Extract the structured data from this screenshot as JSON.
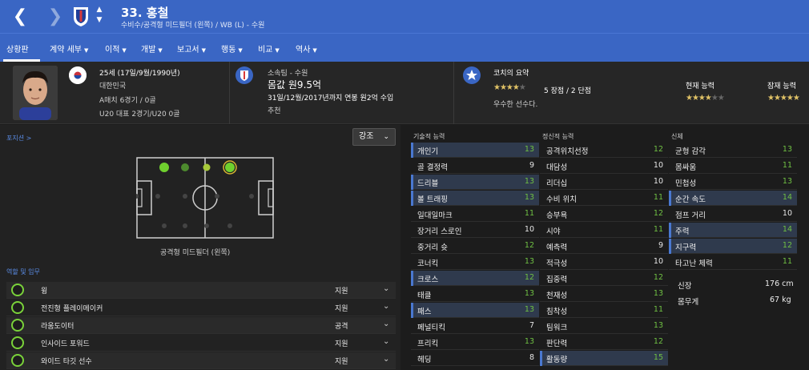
{
  "header": {
    "number_name": "33. 홍철",
    "subtitle": "수비수/공격형 미드필더 (왼쪽) / WB (L) - 수원"
  },
  "tabs": [
    {
      "label": "상황판"
    },
    {
      "label": "계약 세부"
    },
    {
      "label": "이적"
    },
    {
      "label": "개발"
    },
    {
      "label": "보고서"
    },
    {
      "label": "행동"
    },
    {
      "label": "비교"
    },
    {
      "label": "역사"
    }
  ],
  "profile": {
    "age_line": "25세 (17일/9월/1990년)",
    "nationality": "대한민국",
    "a_caps": "A매치 6경기 / 0골",
    "u20_caps": "U20 대표 2경기/U20 0골"
  },
  "contract": {
    "team_line": "소속팀 - 수원",
    "value_line": "몸값 원9.5억",
    "wage_line": "31일/12월/2017년까지 연봉 원2억 수입",
    "status": "추천"
  },
  "coach": {
    "title": "코치의 요약",
    "strengths": "5 장점 / 2 단점",
    "summary": "우수한 선수다.",
    "current_label": "현재 능력",
    "potential_label": "잠재 능력",
    "stars_summary": 3.5,
    "stars_current": 3.5,
    "stars_potential": 4.5
  },
  "position_panel": {
    "link": "포지션 >",
    "highlight_select": "강조",
    "position_label": "공격형 미드필더 (왼쪽)",
    "roles_title": "역할 및 임무"
  },
  "roles": [
    {
      "name": "윙",
      "duty": "지원"
    },
    {
      "name": "전진형 플레이메이커",
      "duty": "지원"
    },
    {
      "name": "라움도이터",
      "duty": "공격"
    },
    {
      "name": "인사이드 포워드",
      "duty": "지원"
    },
    {
      "name": "와이드 타깃 선수",
      "duty": "지원"
    }
  ],
  "technical": {
    "title": "기술적 능력",
    "attrs": [
      {
        "name": "개인기",
        "value": "13",
        "hl": true
      },
      {
        "name": "골 결정력",
        "value": "9",
        "hl": false
      },
      {
        "name": "드리블",
        "value": "13",
        "hl": true
      },
      {
        "name": "볼 트래핑",
        "value": "13",
        "hl": true
      },
      {
        "name": "일대일마크",
        "value": "11",
        "hl": false
      },
      {
        "name": "장거리 스로인",
        "value": "10",
        "hl": false
      },
      {
        "name": "중거리 슛",
        "value": "12",
        "hl": false
      },
      {
        "name": "코너킥",
        "value": "13",
        "hl": false
      },
      {
        "name": "크로스",
        "value": "12",
        "hl": true
      },
      {
        "name": "태클",
        "value": "13",
        "hl": false
      },
      {
        "name": "패스",
        "value": "13",
        "hl": true
      },
      {
        "name": "페널티킥",
        "value": "7",
        "hl": false
      },
      {
        "name": "프리킥",
        "value": "13",
        "hl": false
      },
      {
        "name": "헤딩",
        "value": "8",
        "hl": false
      }
    ]
  },
  "mental": {
    "title": "정신적 능력",
    "attrs": [
      {
        "name": "공격위치선정",
        "value": "12",
        "hl": false
      },
      {
        "name": "대담성",
        "value": "10",
        "hl": false
      },
      {
        "name": "리더십",
        "value": "10",
        "hl": false
      },
      {
        "name": "수비 위치",
        "value": "11",
        "hl": false
      },
      {
        "name": "승부욕",
        "value": "12",
        "hl": false
      },
      {
        "name": "시야",
        "value": "11",
        "hl": false
      },
      {
        "name": "예측력",
        "value": "9",
        "hl": false
      },
      {
        "name": "적극성",
        "value": "10",
        "hl": false
      },
      {
        "name": "집중력",
        "value": "12",
        "hl": false
      },
      {
        "name": "천재성",
        "value": "13",
        "hl": false
      },
      {
        "name": "침착성",
        "value": "11",
        "hl": false
      },
      {
        "name": "팀워크",
        "value": "13",
        "hl": false
      },
      {
        "name": "판단력",
        "value": "12",
        "hl": false
      },
      {
        "name": "활동량",
        "value": "15",
        "hl": true
      }
    ]
  },
  "physical": {
    "title": "신체",
    "attrs": [
      {
        "name": "균형 감각",
        "value": "13",
        "hl": false
      },
      {
        "name": "몸싸움",
        "value": "11",
        "hl": false
      },
      {
        "name": "민첩성",
        "value": "13",
        "hl": false
      },
      {
        "name": "순간 속도",
        "value": "14",
        "hl": true
      },
      {
        "name": "점프 거리",
        "value": "10",
        "hl": false
      },
      {
        "name": "주력",
        "value": "14",
        "hl": true
      },
      {
        "name": "지구력",
        "value": "12",
        "hl": true
      },
      {
        "name": "타고난 체력",
        "value": "11",
        "hl": false
      }
    ],
    "height_label": "신장",
    "height_value": "176 cm",
    "weight_label": "몸무게",
    "weight_value": "67 kg"
  }
}
